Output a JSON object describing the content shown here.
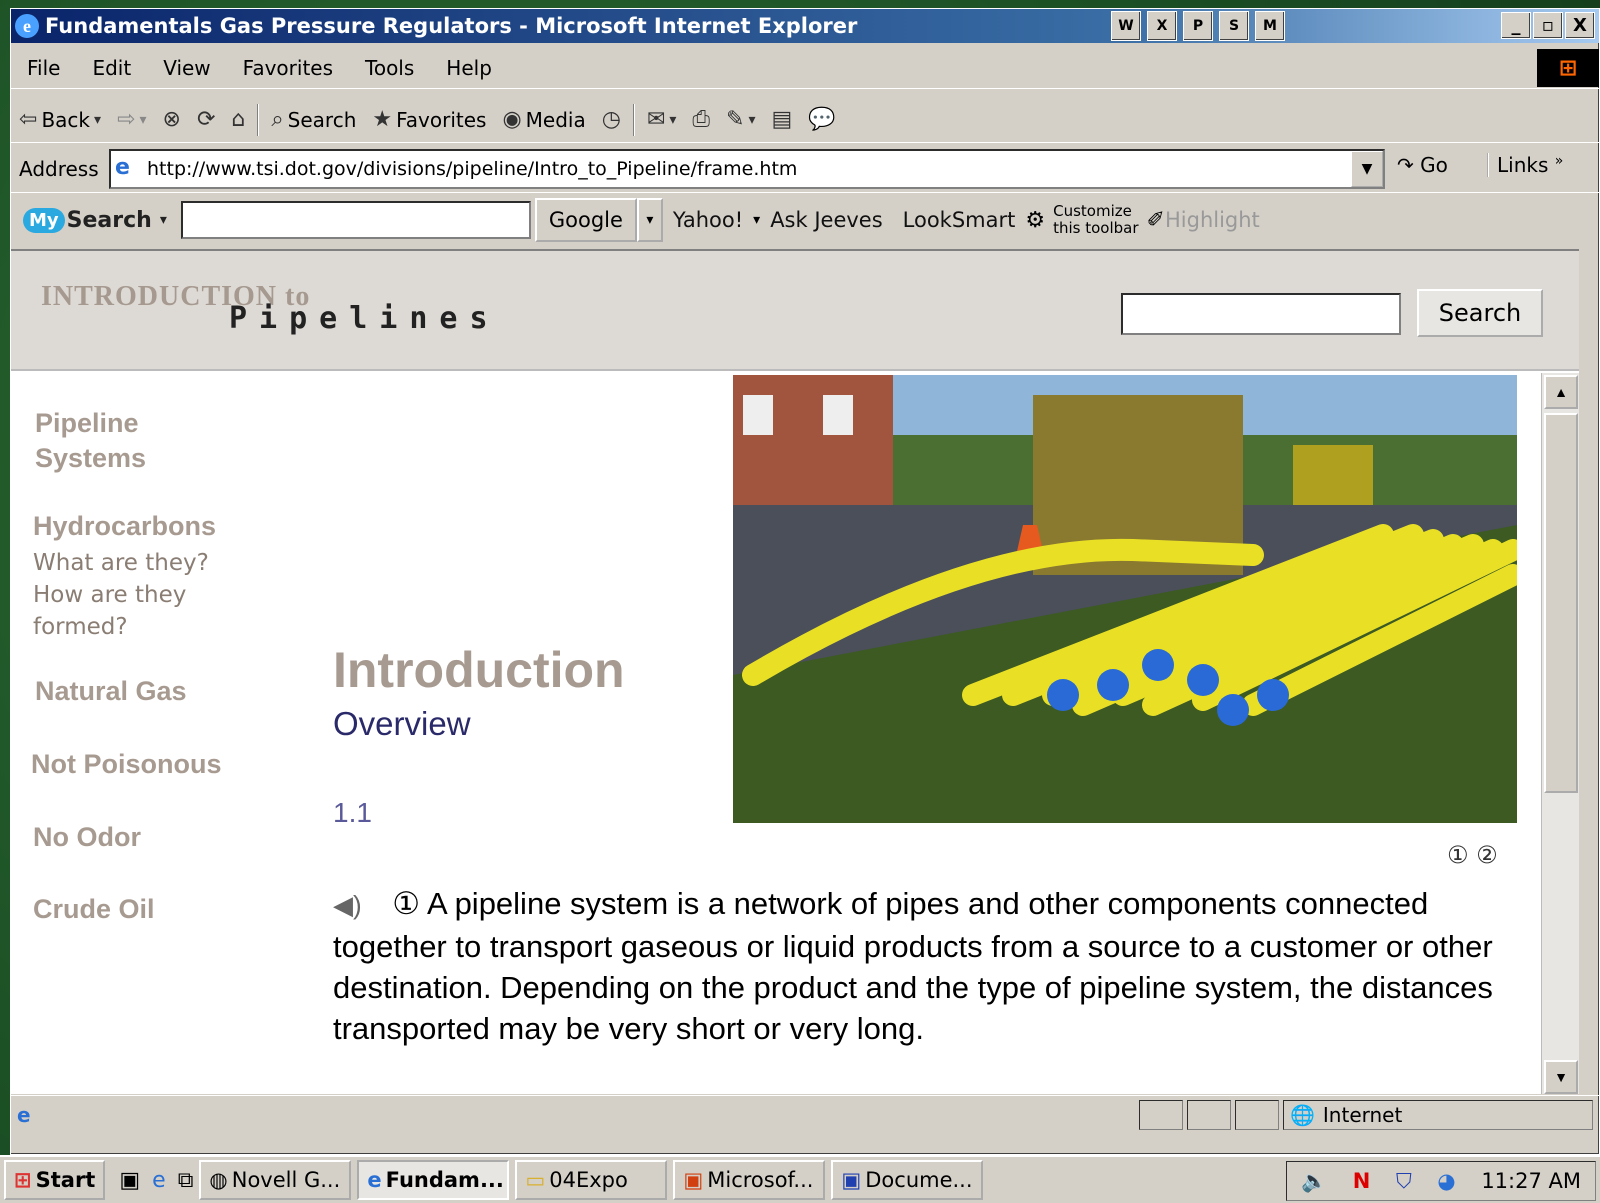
{
  "window": {
    "title": "Fundamentals Gas Pressure Regulators - Microsoft Internet Explorer",
    "app_icons": [
      "W",
      "X",
      "P",
      "S",
      "M"
    ],
    "controls": [
      "_",
      "▫",
      "X"
    ]
  },
  "menu": [
    "File",
    "Edit",
    "View",
    "Favorites",
    "Tools",
    "Help"
  ],
  "toolbar": {
    "back": "Back",
    "search": "Search",
    "favorites": "Favorites",
    "media": "Media"
  },
  "address": {
    "label": "Address",
    "url": "http://www.tsi.dot.gov/divisions/pipeline/Intro_to_Pipeline/frame.htm",
    "go": "Go",
    "links": "Links"
  },
  "search_toolbar": {
    "brand_my": "My",
    "brand_search": "Search",
    "engines": [
      "Google",
      "Yahoo!",
      "Ask Jeeves",
      "LookSmart"
    ],
    "customize": [
      "Customize",
      "this toolbar"
    ],
    "highlight": "Highlight"
  },
  "page": {
    "logo_small": "INTRODUCTION to",
    "logo_big": "Pipelines",
    "search_button": "Search",
    "nav": {
      "pipeline_systems": [
        "Pipeline",
        "Systems"
      ],
      "hydrocarbons": "Hydrocarbons",
      "hydro_sub": [
        "What are they?",
        "How are they",
        "formed?"
      ],
      "natural_gas": "Natural Gas",
      "not_poisonous": "Not Poisonous",
      "no_odor": "No Odor",
      "crude_oil": "Crude Oil"
    },
    "heading": "Introduction",
    "subheading": "Overview",
    "section_number": "1.1",
    "pager": "① ②",
    "para_marker": "①",
    "paragraph": "A pipeline system is a network of pipes and other components connected together to transport gaseous or liquid products from a source to a customer or other destination. Depending on the product and the type of pipeline system, the distances transported may be very short or very long."
  },
  "status": {
    "zone": "Internet"
  },
  "taskbar": {
    "start": "Start",
    "tasks": [
      "Novell G...",
      "Fundam...",
      "04Expo",
      "Microsof...",
      "Docume..."
    ],
    "active_index": 1,
    "tray_n": "N",
    "time": "11:27 AM"
  }
}
